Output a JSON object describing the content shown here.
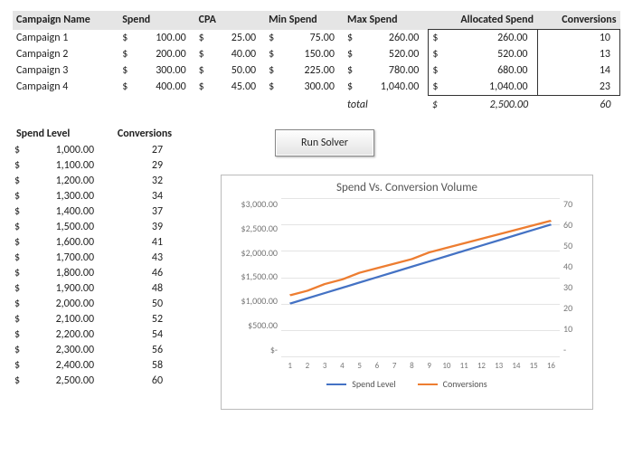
{
  "camp_headers": [
    "Campaign Name",
    "Spend",
    "CPA",
    "Min Spend",
    "Max Spend",
    "Allocated Spend",
    "Conversions"
  ],
  "campaigns": [
    {
      "name": "Campaign 1",
      "spend": "100.00",
      "cpa": "25.00",
      "min": "75.00",
      "max": "260.00",
      "alloc": "260.00",
      "conv": "10"
    },
    {
      "name": "Campaign 2",
      "spend": "200.00",
      "cpa": "40.00",
      "min": "150.00",
      "max": "520.00",
      "alloc": "520.00",
      "conv": "13"
    },
    {
      "name": "Campaign 3",
      "spend": "300.00",
      "cpa": "50.00",
      "min": "225.00",
      "max": "780.00",
      "alloc": "680.00",
      "conv": "14"
    },
    {
      "name": "Campaign 4",
      "spend": "400.00",
      "cpa": "45.00",
      "min": "300.00",
      "max": "1,040.00",
      "alloc": "1,040.00",
      "conv": "23"
    }
  ],
  "total_label": "total",
  "total_alloc": "2,500.00",
  "total_conv": "60",
  "level_headers": [
    "Spend Level",
    "Conversions"
  ],
  "levels": [
    {
      "spend": "1,000.00",
      "conv": "27"
    },
    {
      "spend": "1,100.00",
      "conv": "29"
    },
    {
      "spend": "1,200.00",
      "conv": "32"
    },
    {
      "spend": "1,300.00",
      "conv": "34"
    },
    {
      "spend": "1,400.00",
      "conv": "37"
    },
    {
      "spend": "1,500.00",
      "conv": "39"
    },
    {
      "spend": "1,600.00",
      "conv": "41"
    },
    {
      "spend": "1,700.00",
      "conv": "43"
    },
    {
      "spend": "1,800.00",
      "conv": "46"
    },
    {
      "spend": "1,900.00",
      "conv": "48"
    },
    {
      "spend": "2,000.00",
      "conv": "50"
    },
    {
      "spend": "2,100.00",
      "conv": "52"
    },
    {
      "spend": "2,200.00",
      "conv": "54"
    },
    {
      "spend": "2,300.00",
      "conv": "56"
    },
    {
      "spend": "2,400.00",
      "conv": "58"
    },
    {
      "spend": "2,500.00",
      "conv": "60"
    }
  ],
  "solver_label": "Run Solver",
  "currency": "$",
  "chart_title": "Spend Vs. Conversion Volume",
  "left_ticks": [
    "$3,000.00",
    "$2,500.00",
    "$2,000.00",
    "$1,500.00",
    "$1,000.00",
    "$500.00",
    "$-"
  ],
  "right_ticks": [
    "70",
    "60",
    "50",
    "40",
    "30",
    "20",
    "10",
    "-"
  ],
  "x_ticks": [
    "1",
    "2",
    "3",
    "4",
    "5",
    "6",
    "7",
    "8",
    "9",
    "10",
    "11",
    "12",
    "13",
    "14",
    "15",
    "16"
  ],
  "legend": {
    "s1": "Spend Level",
    "s2": "Conversions"
  },
  "colors": {
    "spend": "#4472c4",
    "conv": "#ed7d31",
    "grid": "#e4e4e4"
  },
  "chart_data": {
    "type": "line",
    "title": "Spend Vs. Conversion Volume",
    "x": [
      1,
      2,
      3,
      4,
      5,
      6,
      7,
      8,
      9,
      10,
      11,
      12,
      13,
      14,
      15,
      16
    ],
    "series": [
      {
        "name": "Spend Level",
        "axis": "left",
        "values": [
          1000,
          1100,
          1200,
          1300,
          1400,
          1500,
          1600,
          1700,
          1800,
          1900,
          2000,
          2100,
          2200,
          2300,
          2400,
          2500
        ]
      },
      {
        "name": "Conversions",
        "axis": "right",
        "values": [
          27,
          29,
          32,
          34,
          37,
          39,
          41,
          43,
          46,
          48,
          50,
          52,
          54,
          56,
          58,
          60
        ]
      }
    ],
    "ylim_left": [
      0,
      3000
    ],
    "ylim_right": [
      0,
      70
    ],
    "xlabel": "",
    "ylabel_left": "",
    "ylabel_right": ""
  }
}
